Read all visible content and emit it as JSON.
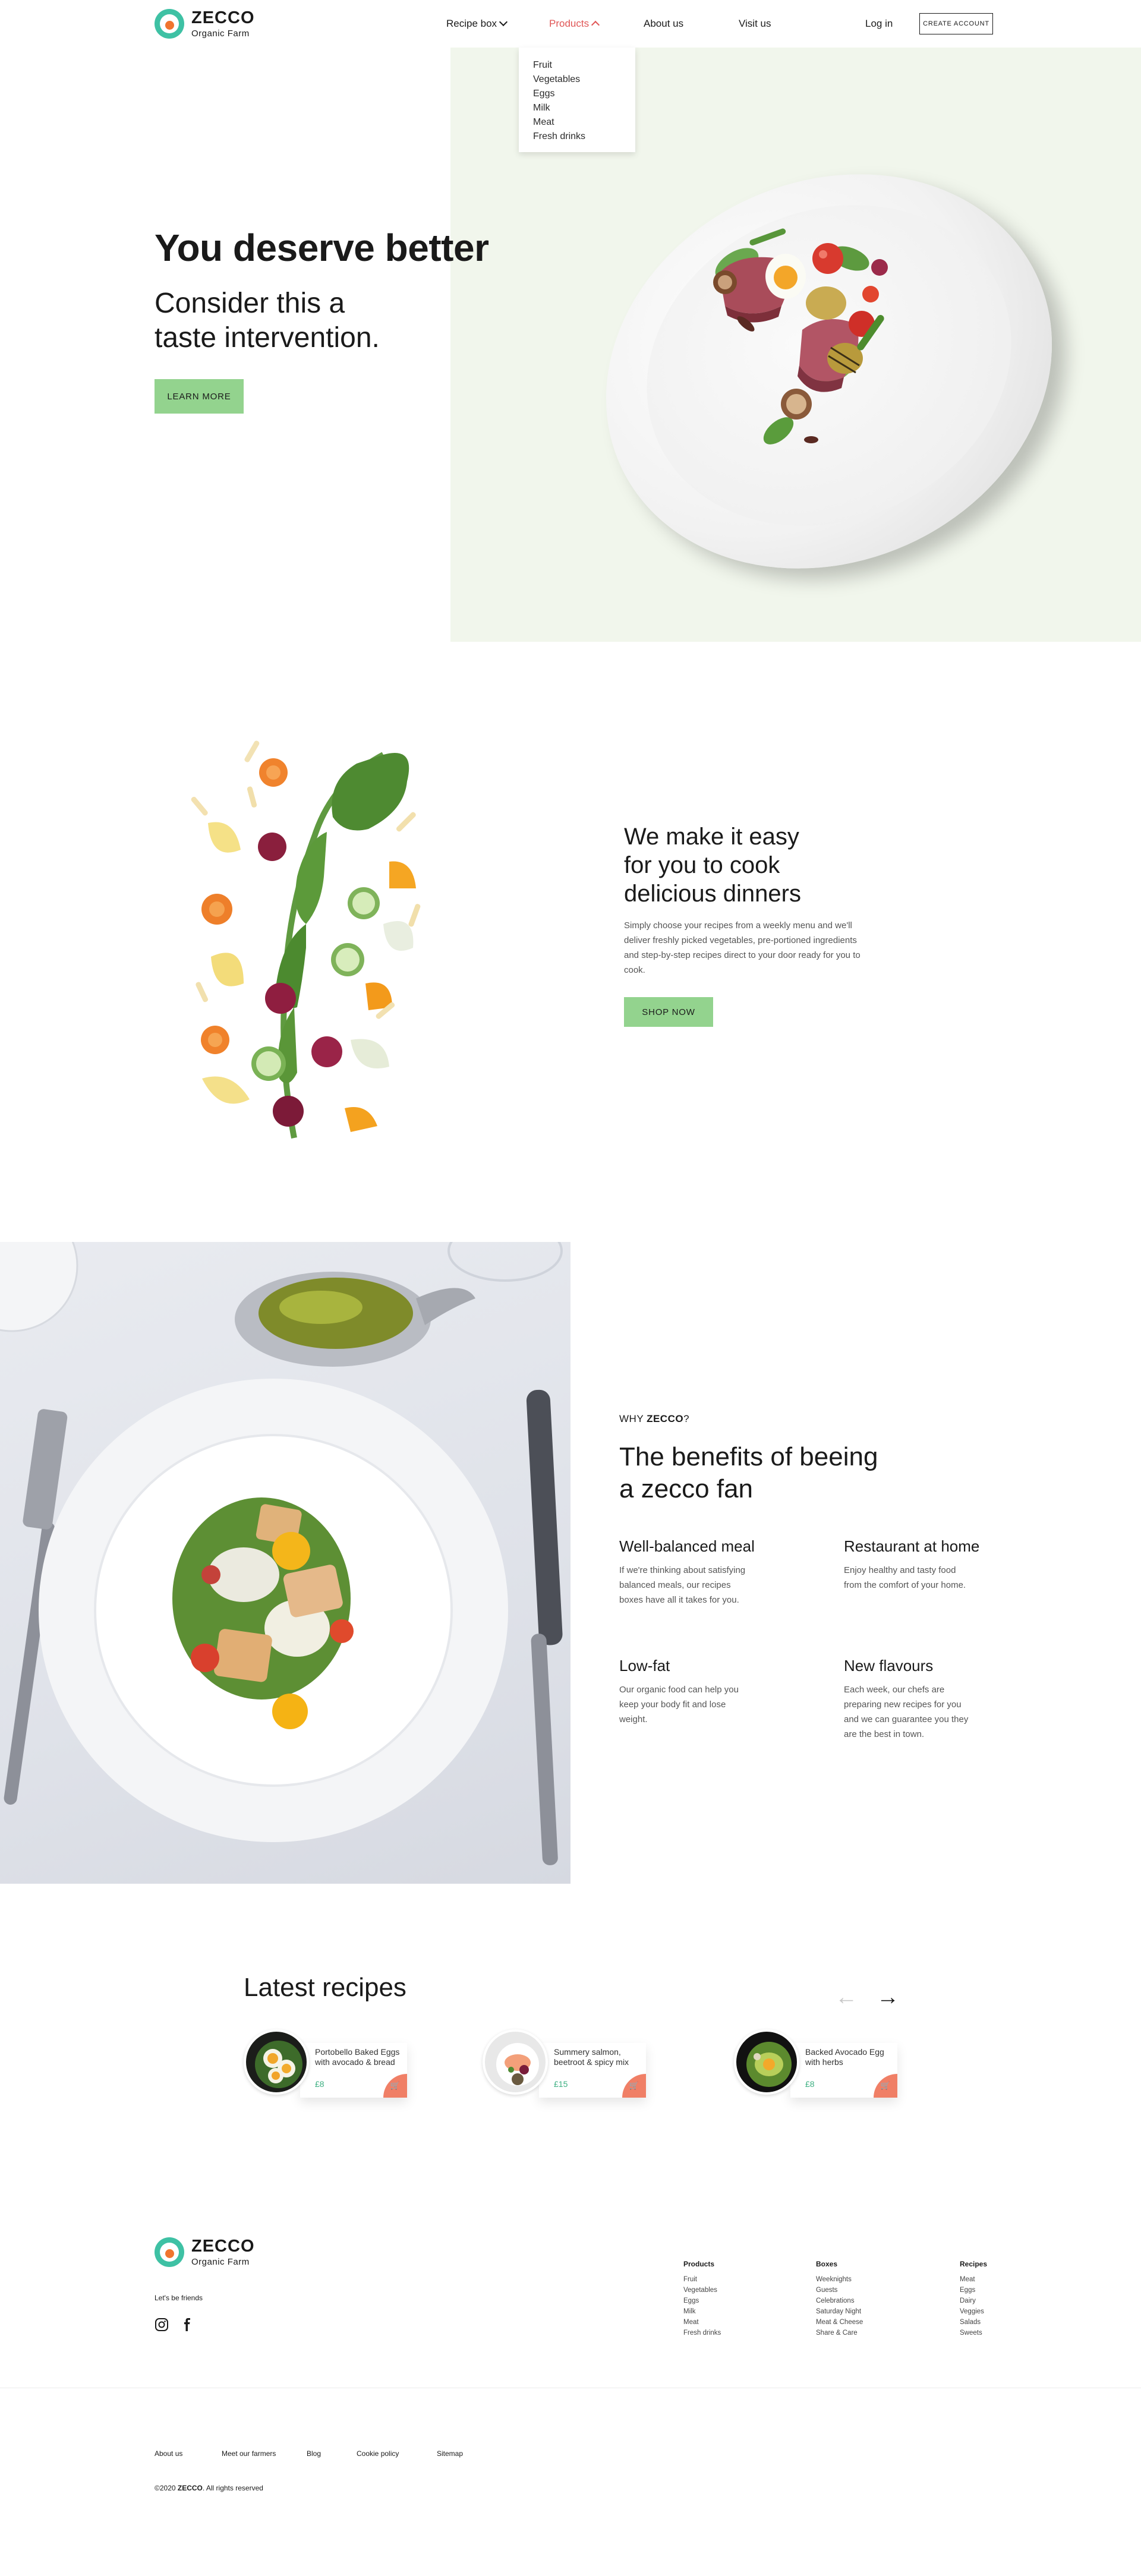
{
  "brand": {
    "name": "ZECCO",
    "tagline": "Organic Farm",
    "colors": {
      "teal": "#3ec1a4",
      "orange": "#f0752e",
      "green_button": "#93d38e",
      "hero_bg": "#f1f6ec",
      "active_nav": "#e05656",
      "cart": "#f07f66"
    }
  },
  "nav": {
    "recipe_box": "Recipe box",
    "products": "Products",
    "about": "About us",
    "visit": "Visit us",
    "login": "Log in",
    "create_account": "CREATE ACCOUNT",
    "products_dropdown": [
      "Fruit",
      "Vegetables",
      "Eggs",
      "Milk",
      "Meat",
      "Fresh drinks"
    ]
  },
  "hero": {
    "title": "You deserve better",
    "subtitle_line1": "Consider this a",
    "subtitle_line2": "taste intervention.",
    "cta": "LEARN MORE"
  },
  "easy": {
    "title_line1": "We make it easy",
    "title_line2": "for you to cook",
    "title_line3": "delicious dinners",
    "body": "Simply choose your recipes from a weekly menu and we'll deliver freshly picked vegetables,  pre-portioned ingredients and step-by-step recipes direct to your door ready for you to cook.",
    "cta": "SHOP NOW"
  },
  "benefits": {
    "eyebrow_prefix": "WHY ",
    "eyebrow_brand": "ZECCO",
    "eyebrow_suffix": "?",
    "title_line1": "The benefits of beeing",
    "title_line2": "a zecco fan",
    "items": [
      {
        "title": "Well-balanced meal",
        "text": "If we're thinking about satisfying balanced meals, our recipes boxes have all it takes for you."
      },
      {
        "title": "Restaurant at home",
        "text": "Enjoy healthy and tasty food from the comfort of your home."
      },
      {
        "title": "Low-fat",
        "text": "Our organic food can help you keep your body fit and lose weight."
      },
      {
        "title": "New flavours",
        "text": "Each week, our chefs are preparing new recipes for you and we can guarantee you they are the best in town."
      }
    ]
  },
  "recipes": {
    "title": "Latest recipes",
    "prev_icon": "arrow-left-icon",
    "next_icon": "arrow-right-icon",
    "cards": [
      {
        "title": "Portobello Baked Eggs with avocado & bread",
        "price": "£8"
      },
      {
        "title": "Summery salmon, beetroot & spicy mix",
        "price": "£15"
      },
      {
        "title": "Backed Avocado Egg with herbs",
        "price": "£8"
      }
    ]
  },
  "footer": {
    "friends": "Let's be friends",
    "social": [
      "instagram-icon",
      "facebook-icon"
    ],
    "columns": [
      {
        "heading": "Products",
        "links": [
          "Fruit",
          "Vegetables",
          "Eggs",
          "Milk",
          "Meat",
          "Fresh drinks"
        ]
      },
      {
        "heading": "Boxes",
        "links": [
          "Weeknights",
          "Guests",
          "Celebrations",
          "Saturday Night",
          "Meat & Cheese",
          "Share & Care"
        ]
      },
      {
        "heading": "Recipes",
        "links": [
          "Meat",
          "Eggs",
          "Dairy",
          "Veggies",
          "Salads",
          "Sweets"
        ]
      }
    ],
    "bottom_links": [
      "About us",
      "Meet our farmers",
      "Blog",
      "Cookie policy",
      "Sitemap"
    ],
    "copyright_prefix": "©2020 ",
    "copyright_brand": "ZECCO",
    "copyright_suffix": ". All rights reserved"
  }
}
